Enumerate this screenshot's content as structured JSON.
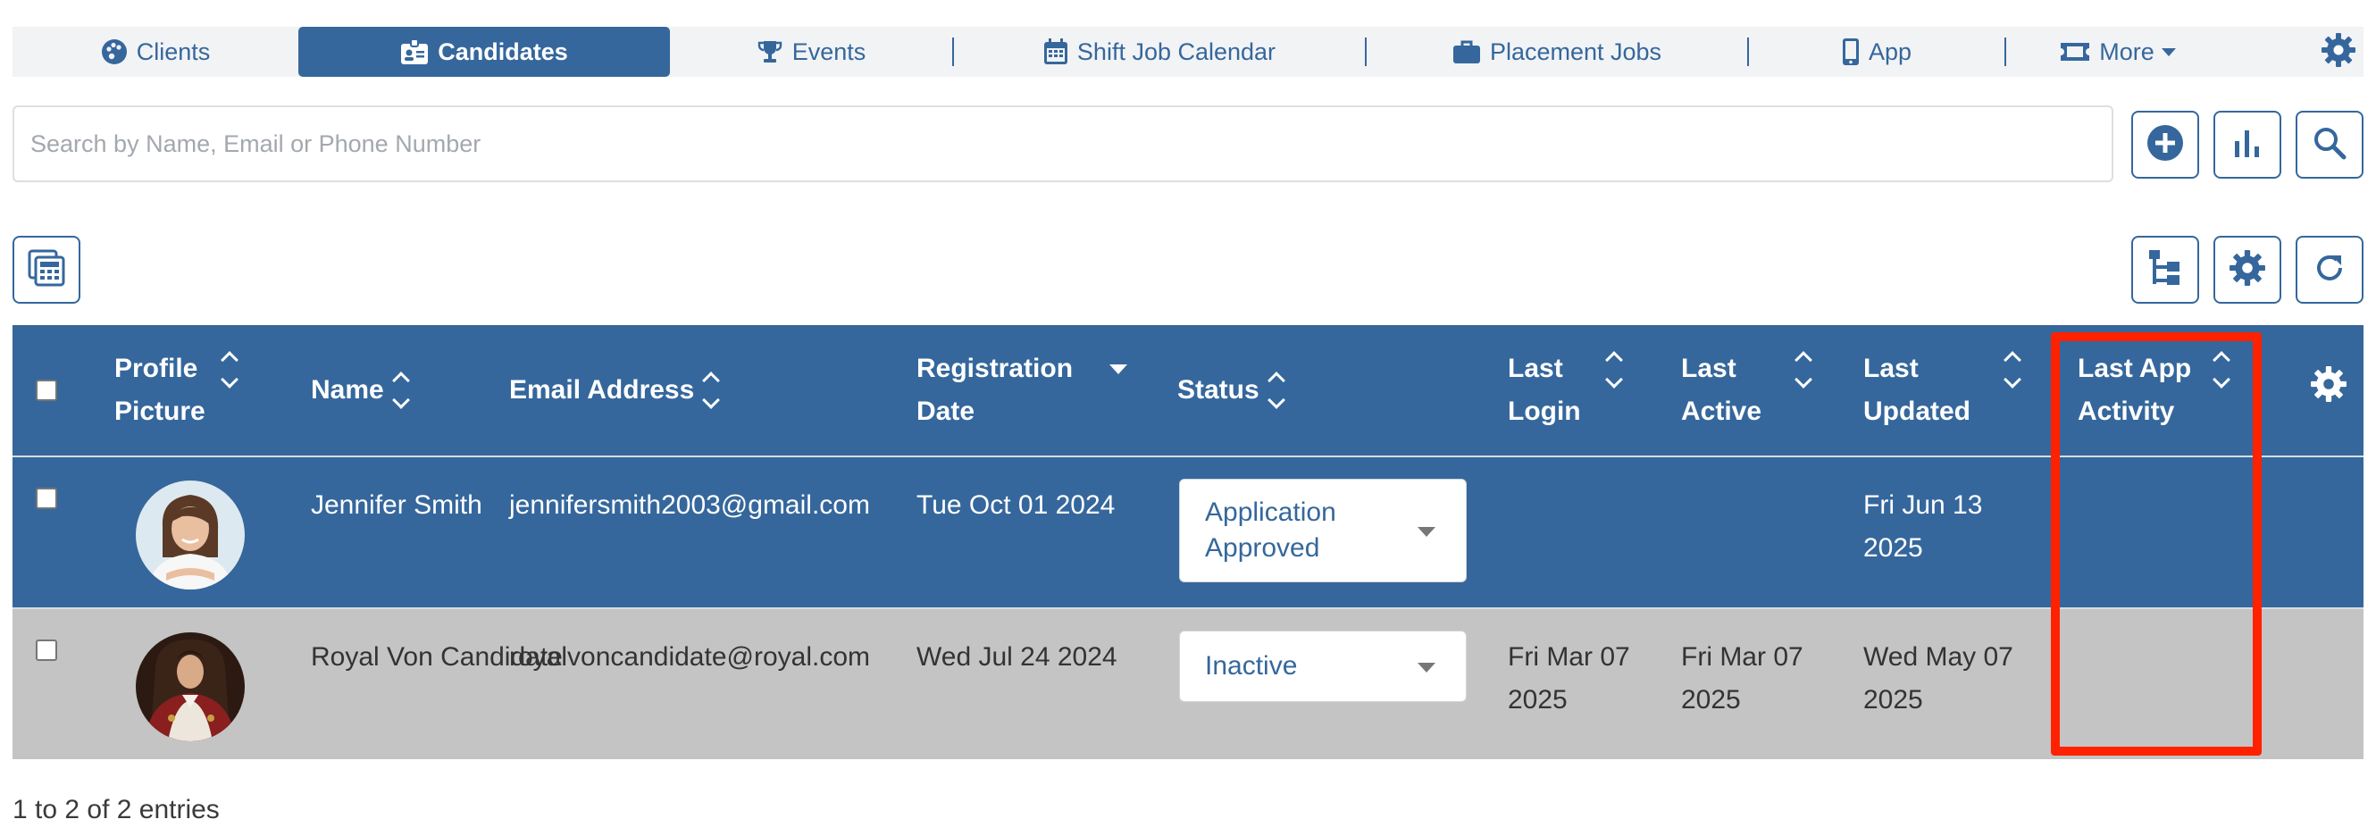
{
  "nav": {
    "items": [
      {
        "label": "Clients",
        "icon": "palette-icon"
      },
      {
        "label": "Candidates",
        "icon": "id-badge-icon"
      },
      {
        "label": "Events",
        "icon": "trophy-icon"
      },
      {
        "label": "Shift Job Calendar",
        "icon": "calendar-icon"
      },
      {
        "label": "Placement Jobs",
        "icon": "briefcase-icon"
      },
      {
        "label": "App",
        "icon": "mobile-icon"
      },
      {
        "label": "More",
        "icon": "ticket-icon"
      }
    ],
    "active": "Candidates"
  },
  "search": {
    "placeholder": "Search by Name, Email or Phone Number",
    "value": ""
  },
  "toolbar": {
    "icons": [
      "add-circle-icon",
      "bar-chart-icon",
      "search-icon",
      "calculator-icon",
      "hierarchy-icon",
      "gear-icon",
      "refresh-icon"
    ]
  },
  "table": {
    "columns": [
      {
        "label": "Profile Picture",
        "sort": "both"
      },
      {
        "label": "Name",
        "sort": "both"
      },
      {
        "label": "Email Address",
        "sort": "both"
      },
      {
        "label": "Registration Date",
        "sort": "desc"
      },
      {
        "label": "Status",
        "sort": "both"
      },
      {
        "label": "Last Login",
        "sort": "both"
      },
      {
        "label": "Last Active",
        "sort": "both"
      },
      {
        "label": "Last Updated",
        "sort": "both"
      },
      {
        "label": "Last App Activity",
        "sort": "both"
      }
    ],
    "rows": [
      {
        "name": "Jennifer Smith",
        "email": "jennifersmith2003@gmail.com",
        "registration_date": "Tue Oct 01 2024",
        "status": "Application Approved",
        "last_login": "",
        "last_active": "",
        "last_updated": "Fri Jun 13 2025",
        "last_app_activity": ""
      },
      {
        "name": "Royal Von Candidate",
        "email": "royalvoncandidate@royal.com",
        "registration_date": "Wed Jul 24 2024",
        "status": "Inactive",
        "last_login": "Fri Mar 07 2025",
        "last_active": "Fri Mar 07 2025",
        "last_updated": "Wed May 07 2025",
        "last_app_activity": ""
      }
    ],
    "footer": "1 to 2 of 2 entries"
  },
  "colors": {
    "brand": "#35679c",
    "highlight": "#ff2200",
    "row_alt": "#c4c4c4"
  }
}
